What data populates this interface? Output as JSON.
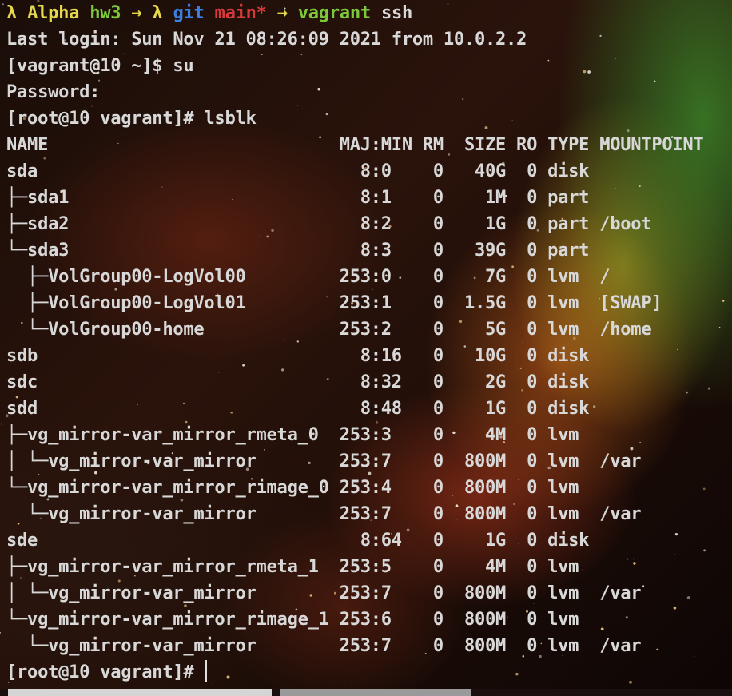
{
  "colors": {
    "prompt_yellow": "#e5d84a",
    "prompt_green": "#7cc83a",
    "git_blue": "#3a7fe0",
    "branch_red": "#d83a3a",
    "text": "#d8d8d8"
  },
  "prompt": {
    "lambda1": "λ",
    "host": "Alpha",
    "dir": "hw3",
    "arrow1": "→",
    "lambda2": "λ",
    "git": "git",
    "branch": "main*",
    "arrow2": "→",
    "cmd_vagrant": "vagrant",
    "cmd_ssh": "ssh"
  },
  "session": {
    "last_login": "Last login: Sun Nov 21 08:26:09 2021 from 10.0.2.2",
    "su_line": "[vagrant@10 ~]$ su",
    "password": "Password:",
    "lsblk_cmd": "[root@10 vagrant]# lsblk",
    "final_prompt": "[root@10 vagrant]# "
  },
  "lsblk": {
    "header": "NAME                            MAJ:MIN RM  SIZE RO TYPE MOUNTPOINT",
    "rows": [
      "sda                               8:0    0   40G  0 disk",
      "├─sda1                            8:1    0    1M  0 part",
      "├─sda2                            8:2    0    1G  0 part /boot",
      "└─sda3                            8:3    0   39G  0 part",
      "  ├─VolGroup00-LogVol00         253:0    0    7G  0 lvm  /",
      "  ├─VolGroup00-LogVol01         253:1    0  1.5G  0 lvm  [SWAP]",
      "  └─VolGroup00-home             253:2    0    5G  0 lvm  /home",
      "sdb                               8:16   0   10G  0 disk",
      "sdc                               8:32   0    2G  0 disk",
      "sdd                               8:48   0    1G  0 disk",
      "├─vg_mirror-var_mirror_rmeta_0  253:3    0    4M  0 lvm",
      "│ └─vg_mirror-var_mirror        253:7    0  800M  0 lvm  /var",
      "└─vg_mirror-var_mirror_rimage_0 253:4    0  800M  0 lvm",
      "  └─vg_mirror-var_mirror        253:7    0  800M  0 lvm  /var",
      "sde                               8:64   0    1G  0 disk",
      "├─vg_mirror-var_mirror_rmeta_1  253:5    0    4M  0 lvm",
      "│ └─vg_mirror-var_mirror        253:7    0  800M  0 lvm  /var",
      "└─vg_mirror-var_mirror_rimage_1 253:6    0  800M  0 lvm",
      "  └─vg_mirror-var_mirror        253:7    0  800M  0 lvm  /var"
    ]
  }
}
